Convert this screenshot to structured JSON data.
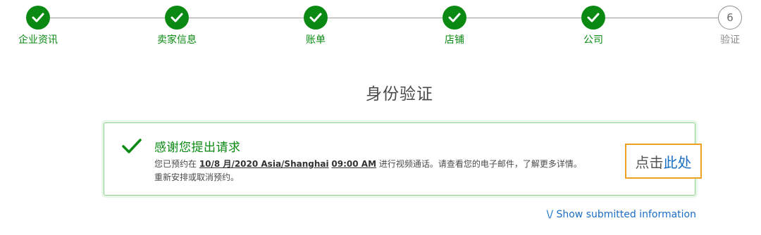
{
  "stepper": {
    "steps": [
      {
        "label": "企业资讯",
        "state": "done"
      },
      {
        "label": "卖家信息",
        "state": "done"
      },
      {
        "label": "账单",
        "state": "done"
      },
      {
        "label": "店铺",
        "state": "done"
      },
      {
        "label": "公司",
        "state": "done"
      },
      {
        "label": "验证",
        "state": "current",
        "number": "6"
      }
    ]
  },
  "page": {
    "title": "身份验证"
  },
  "alert": {
    "title": "感谢您提出请求",
    "body_prefix": "您已预约在 ",
    "date": "10/8 月/2020 Asia/Shanghai",
    "space": " ",
    "time": "09:00 AM",
    "body_suffix": " 进行视频通话。请查看您的电子邮件，了解更多详情。",
    "body_line2": "重新安排或取消预约。"
  },
  "click_here": {
    "prefix": "点击",
    "link": "此处"
  },
  "show_info": {
    "label": "\\/ Show submitted information"
  },
  "colors": {
    "success": "#0a8a12",
    "link": "#1a6ec4",
    "highlight": "#f0a020"
  }
}
